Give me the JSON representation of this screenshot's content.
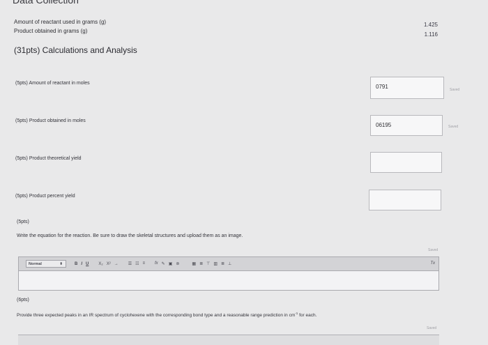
{
  "header": {
    "title": "Data Collection"
  },
  "data_collection": {
    "rows": [
      {
        "label": "Amount of reactant used in grams (g)",
        "value": "1.425"
      },
      {
        "label": "Product obtained in grams (g)",
        "value": "1.116"
      }
    ]
  },
  "section": {
    "title": "(31pts) Calculations and Analysis"
  },
  "questions": [
    {
      "label": "(5pts)  Amount of reactant in moles",
      "value": "0791",
      "status": "Saved"
    },
    {
      "label": "(5pts)  Product obtained in moles",
      "value": "06195",
      "status": "Saved"
    },
    {
      "label": "(5pts)  Product theoretical yield",
      "value": "",
      "status": ""
    },
    {
      "label": "(5pts)  Product percent yield",
      "value": "",
      "status": ""
    }
  ],
  "q5": {
    "points": "(5pts)",
    "prompt": "Write the equation for the reaction. Be sure to draw the skeletal structures and upload them as an image.",
    "status": "Saved"
  },
  "editor": {
    "format_select": "Normal",
    "format_arrow": "⬍",
    "buttons_inline": [
      "B",
      "I",
      "U"
    ],
    "buttons_script": [
      "X₂",
      "X²",
      "→"
    ],
    "buttons_list": [
      "☰",
      "☷",
      "≡"
    ],
    "buttons_insert": [
      "fx",
      "✎",
      "▣",
      "⊚"
    ],
    "buttons_table": [
      "▦",
      "≣",
      "⊤",
      "▥",
      "≣",
      "⊥"
    ],
    "clear_format": "Tx"
  },
  "q6": {
    "points": "(6pts)",
    "prompt": "Provide three expected peaks in an IR spectrum of cyclohexene with the corresponding bond type and a reasonable range prediction in cm",
    "superscript": "-1",
    "prompt_tail": " for each.",
    "status": "Saved"
  }
}
